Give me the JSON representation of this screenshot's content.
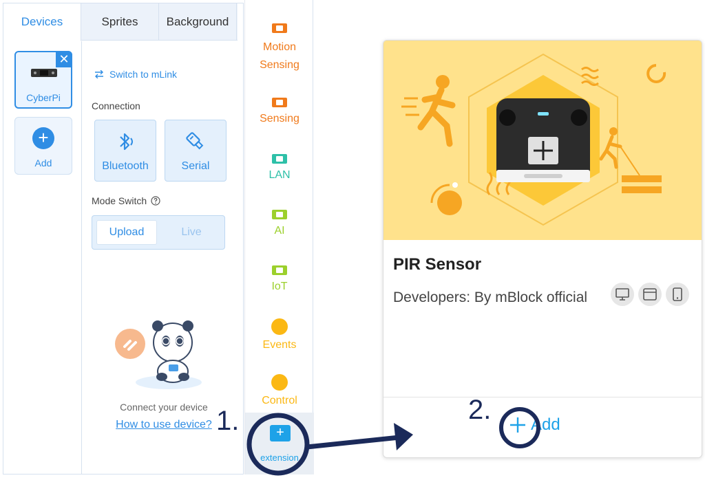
{
  "tabs": [
    {
      "label": "Devices"
    },
    {
      "label": "Sprites"
    },
    {
      "label": "Background"
    }
  ],
  "device": {
    "name": "CyberPi",
    "close_glyph": "✕",
    "add_label": "Add",
    "add_glyph": "+"
  },
  "connection": {
    "switch_label": "Switch to mLink",
    "section_label": "Connection",
    "bluetooth_label": "Bluetooth",
    "serial_label": "Serial"
  },
  "mode": {
    "section_label": "Mode Switch",
    "upload_label": "Upload",
    "live_label": "Live"
  },
  "empty_state": {
    "text": "Connect your device",
    "link": "How to use device?"
  },
  "categories": [
    {
      "label": "Motion Sensing",
      "color": "#f07a1b",
      "icon": "block-icon"
    },
    {
      "label": "Sensing",
      "color": "#f07a1b",
      "icon": "block-icon"
    },
    {
      "label": "LAN",
      "color": "#2ec0a8",
      "icon": "block-icon"
    },
    {
      "label": "AI",
      "color": "#9cd02c",
      "icon": "block-icon"
    },
    {
      "label": "IoT",
      "color": "#9cd02c",
      "icon": "block-icon"
    },
    {
      "label": "Events",
      "color": "#fbb814",
      "icon": "dot-icon"
    },
    {
      "label": "Control",
      "color": "#fbb814",
      "icon": "dot-icon"
    }
  ],
  "extension_button": {
    "label": "extension",
    "glyph": "+"
  },
  "extension_card": {
    "title": "PIR Sensor",
    "developers": "Developers:  By mBlock official",
    "add_label": "Add",
    "platforms": [
      "desktop-icon",
      "browser-icon",
      "mobile-icon"
    ]
  },
  "annotations": {
    "step1": "1.",
    "step2": "2."
  },
  "colors": {
    "accent": "#2f8de4",
    "extension_blue": "#1ea2e8",
    "card_bg": "#ffe28c",
    "annotation": "#1b2a5a"
  }
}
